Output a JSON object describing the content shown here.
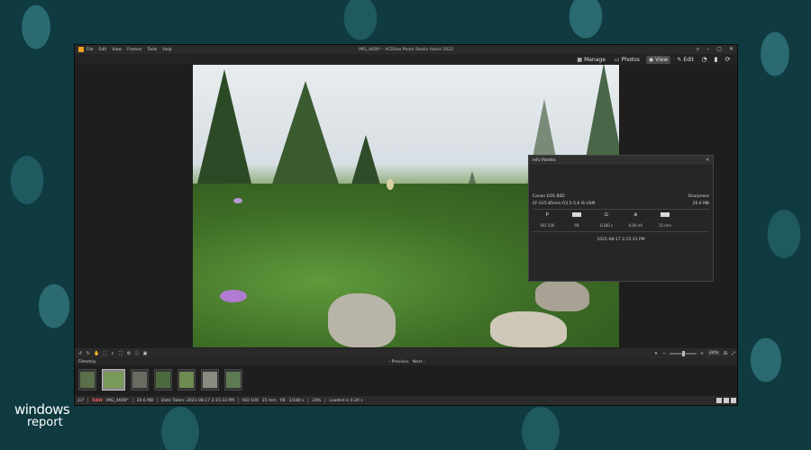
{
  "window": {
    "title": "IMG_4606* - ACDSee Photo Studio Home 2022",
    "menu": [
      "File",
      "Edit",
      "View",
      "Frames",
      "Tools",
      "Help"
    ]
  },
  "modes": {
    "manage": "Manage",
    "photos": "Photos",
    "view": "View",
    "edit": "Edit"
  },
  "info_palette": {
    "title": "Info Palette",
    "camera": "Canon EOS 80D",
    "sharpness": "Sharpness",
    "lens": "EF-S15-85mm f/3.5-5.6 IS USM",
    "file_size": "20.6 MB",
    "exposure_program": "P",
    "iso_label": "ISO",
    "iso_value": "100",
    "aperture": "f/8",
    "shutter": "1/180 s",
    "exposure_comp": "0.00 eV",
    "focal_length": "15 mm",
    "date": "2021-08-17 2:15:33 PM"
  },
  "toolbar": {
    "zoom": "24%"
  },
  "filmstrip": {
    "title": "Filmstrip",
    "previous": "Previous",
    "next": "Next",
    "thumbs": [
      {
        "color": "#5a6f4a"
      },
      {
        "color": "#7a9a5a"
      },
      {
        "color": "#6a6a60"
      },
      {
        "color": "#4c6a3e"
      },
      {
        "color": "#6e8a50"
      },
      {
        "color": "#8a8a80"
      },
      {
        "color": "#5e7a52"
      }
    ]
  },
  "statusbar": {
    "index": "2/7",
    "type": "RAW",
    "filename": "IMG_4606*",
    "size": "20.6 MB",
    "modified": "Date Taken: 2021-08-17 2:15:33 PM",
    "iso": "ISO 100",
    "focal": "15 mm",
    "aperture": "f/8",
    "shutter": "1/180 s",
    "zoom": "24%",
    "loaded": "Loaded in 0.20 s"
  },
  "watermark": {
    "line1": "windows",
    "line2": "report"
  }
}
